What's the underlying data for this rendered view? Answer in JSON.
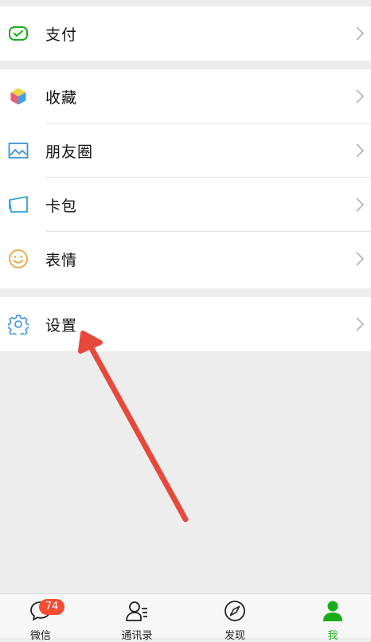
{
  "groups": {
    "pay": {
      "label": "支付",
      "icon": "wallet-check-icon"
    },
    "collection": [
      {
        "label": "收藏",
        "icon": "cube-icon"
      },
      {
        "label": "朋友圈",
        "icon": "photo-album-icon"
      },
      {
        "label": "卡包",
        "icon": "card-icon"
      },
      {
        "label": "表情",
        "icon": "smile-icon"
      }
    ],
    "settings": {
      "label": "设置",
      "icon": "gear-icon"
    }
  },
  "tabbar": {
    "tabs": [
      {
        "label": "微信",
        "icon": "chat-bubble-icon",
        "badge": "74"
      },
      {
        "label": "通讯录",
        "icon": "contacts-icon"
      },
      {
        "label": "发现",
        "icon": "compass-icon"
      },
      {
        "label": "我",
        "icon": "person-icon"
      }
    ]
  },
  "colors": {
    "accent": "#1aad19",
    "badge": "#f74c31",
    "annotation_arrow": "#e8483c",
    "background": "#ededed"
  }
}
